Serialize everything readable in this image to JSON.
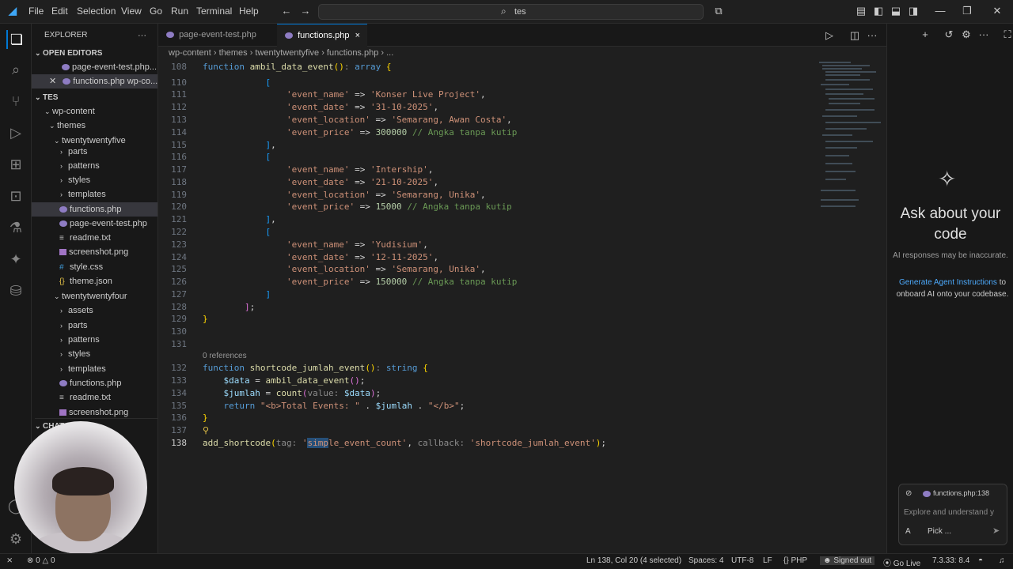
{
  "menu": [
    "File",
    "Edit",
    "Selection",
    "View",
    "Go",
    "Run",
    "Terminal",
    "Help"
  ],
  "search": {
    "text": "tes"
  },
  "explorer": {
    "title": "EXPLORER",
    "open_editors_label": "OPEN EDITORS",
    "open_editors": [
      "page-event-test.php...",
      "functions.php  wp-co..."
    ],
    "workspace_label": "TES",
    "tree": [
      {
        "label": "wp-content",
        "kind": "folder",
        "open": true
      },
      {
        "label": "themes",
        "kind": "folder",
        "open": true
      },
      {
        "label": "twentytwentyfive",
        "kind": "folder",
        "open": true
      },
      {
        "label": "parts",
        "kind": "folder",
        "open": false
      },
      {
        "label": "patterns",
        "kind": "folder",
        "open": false
      },
      {
        "label": "styles",
        "kind": "folder",
        "open": false
      },
      {
        "label": "templates",
        "kind": "folder",
        "open": false
      },
      {
        "label": "functions.php",
        "kind": "php"
      },
      {
        "label": "page-event-test.php",
        "kind": "php"
      },
      {
        "label": "readme.txt",
        "kind": "txt"
      },
      {
        "label": "screenshot.png",
        "kind": "img"
      },
      {
        "label": "style.css",
        "kind": "css"
      },
      {
        "label": "theme.json",
        "kind": "json"
      },
      {
        "label": "twentytwentyfour",
        "kind": "folder",
        "open": true
      },
      {
        "label": "assets",
        "kind": "folder",
        "open": false
      },
      {
        "label": "parts",
        "kind": "folder",
        "open": false
      },
      {
        "label": "patterns",
        "kind": "folder",
        "open": false
      },
      {
        "label": "styles",
        "kind": "folder",
        "open": false
      },
      {
        "label": "templates",
        "kind": "folder",
        "open": false
      },
      {
        "label": "functions.php",
        "kind": "php"
      },
      {
        "label": "readme.txt",
        "kind": "txt"
      },
      {
        "label": "screenshot.png",
        "kind": "img"
      }
    ],
    "chat_section": "CHAT"
  },
  "tabs": [
    {
      "label": "page-event-test.php"
    },
    {
      "label": "functions.php",
      "close": "×"
    }
  ],
  "breadcrumb": "wp-content  ›  themes  ›  twentytwentyfive  ›  functions.php  ›  ...",
  "code": {
    "lines": [
      "108",
      "110",
      "111",
      "112",
      "113",
      "114",
      "115",
      "116",
      "117",
      "118",
      "119",
      "120",
      "121",
      "122",
      "123",
      "124",
      "125",
      "126",
      "127",
      "128",
      "129",
      "130",
      "131",
      "132",
      "133",
      "134",
      "135",
      "136",
      "137",
      "138"
    ],
    "references": "0 references"
  },
  "chat": {
    "title": "Ask about your code",
    "subtitle": "AI responses may be inaccurate.",
    "link": "Generate Agent Instructions",
    "link_suffix": " to onboard AI onto your codebase.",
    "context_file": "functions.php:138",
    "placeholder": "Explore and understand y",
    "mode": "A",
    "pick": "Pick ..."
  },
  "status": {
    "errors": "0",
    "warnings": "0",
    "position": "Ln 138, Col 20 (4 selected)",
    "spaces": "Spaces: 4",
    "encoding": "UTF-8",
    "eol": "LF",
    "language": "PHP",
    "account": "Signed out",
    "golive": "Go Live",
    "version": "7.3.33: 8.4"
  }
}
